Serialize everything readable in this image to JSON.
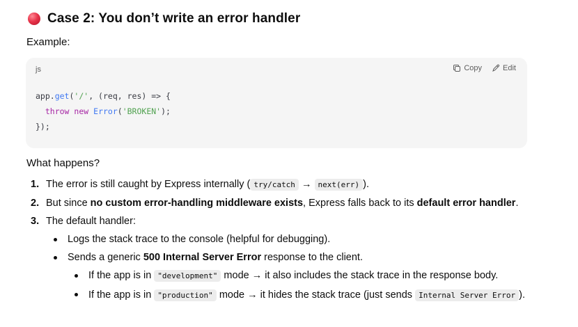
{
  "heading": {
    "title": "Case 2: You don’t write an error handler",
    "icon": "red-circle-icon",
    "icon_color": "#e8344a"
  },
  "example_label": "Example:",
  "code_block": {
    "language": "js",
    "copy_label": "Copy",
    "edit_label": "Edit",
    "lines": [
      "app.get('/', (req, res) => {",
      "  throw new Error('BROKEN');",
      "});"
    ]
  },
  "what_happens": "What happens?",
  "steps": [
    {
      "number": "1.",
      "pre": "The error is still caught by Express internally (",
      "code1": "try/catch",
      "arrow": " → ",
      "code2": "next(err)",
      "post": ")."
    },
    {
      "number": "2.",
      "pre": "But since ",
      "bold1": "no custom error-handling middleware exists",
      "mid": ", Express falls back to its ",
      "bold2": "default error handler",
      "post": "."
    },
    {
      "number": "3.",
      "text": "The default handler:",
      "bullets": [
        {
          "text": "Logs the stack trace to the console (helpful for debugging)."
        },
        {
          "pre": "Sends a generic ",
          "bold": "500 Internal Server Error",
          "post": " response to the client."
        }
      ],
      "sub_bullets": [
        {
          "pre": "If the app is in ",
          "code": "\"development\"",
          "post": " mode → it also includes the stack trace in the response body."
        },
        {
          "pre": "If the app is in ",
          "code": "\"production\"",
          "post": " mode → it hides the stack trace (just sends ",
          "code2": "Internal Server Error",
          "post2": ")."
        }
      ]
    }
  ]
}
